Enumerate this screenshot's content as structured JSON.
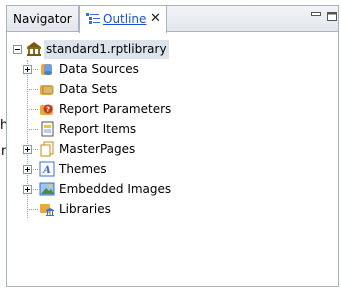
{
  "stray_text": {
    "top": "h",
    "bottom": "n"
  },
  "tabs": {
    "navigator": "Navigator",
    "outline": "Outline"
  },
  "tree": {
    "root": "standard1.rptlibrary",
    "items": [
      {
        "label": "Data Sources",
        "icon": "data-sources-icon",
        "expandable": true
      },
      {
        "label": "Data Sets",
        "icon": "data-sets-icon",
        "expandable": false
      },
      {
        "label": "Report Parameters",
        "icon": "report-parameters-icon",
        "expandable": false
      },
      {
        "label": "Report Items",
        "icon": "report-items-icon",
        "expandable": false
      },
      {
        "label": "MasterPages",
        "icon": "master-pages-icon",
        "expandable": true
      },
      {
        "label": "Themes",
        "icon": "themes-icon",
        "expandable": true
      },
      {
        "label": "Embedded Images",
        "icon": "embedded-images-icon",
        "expandable": true
      },
      {
        "label": "Libraries",
        "icon": "libraries-icon",
        "expandable": false
      }
    ]
  },
  "colors": {
    "outline_tab_text": "#1a4fd6",
    "border": "#a9b4c2",
    "root_highlight": "#dde3ea"
  }
}
